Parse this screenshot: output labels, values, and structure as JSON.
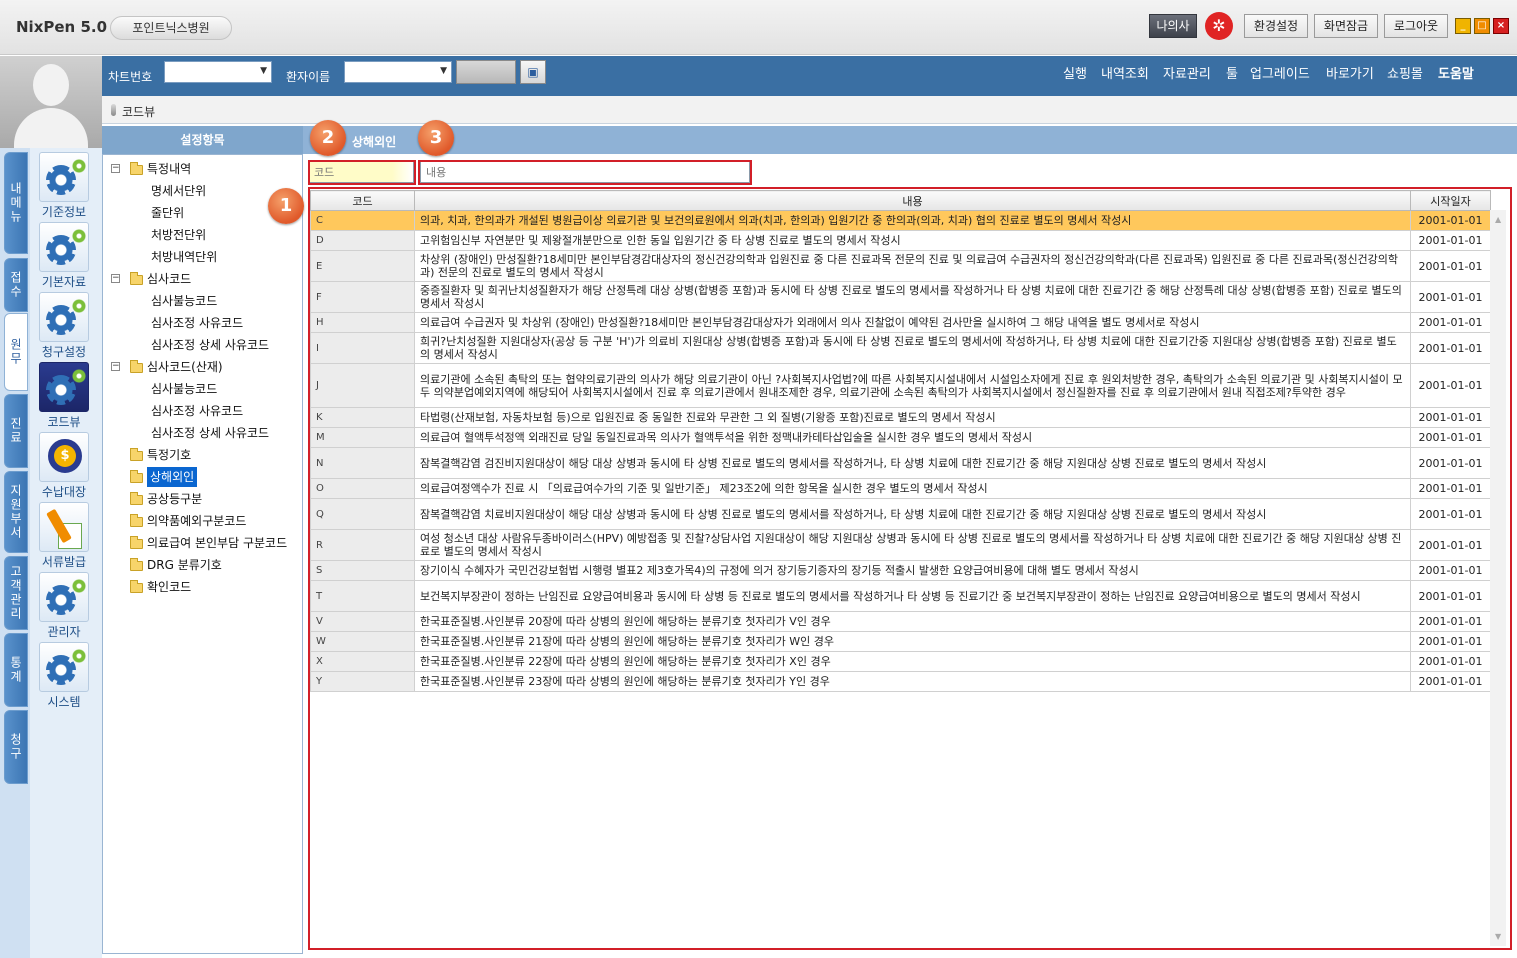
{
  "app": {
    "title": "NixPen 5.0",
    "hospital": "포인트닉스병원"
  },
  "header_buttons": {
    "my_doctor": "나의사",
    "settings": "환경설정",
    "screen_lock": "화면잠금",
    "logout": "로그아웃"
  },
  "window_controls": {
    "minimize": "_",
    "maximize": "□",
    "close": "×"
  },
  "toolbar": {
    "chart_no_label": "차트번호",
    "patient_name_label": "환자이름",
    "menu": [
      "실행",
      "내역조회",
      "자료관리",
      "툴",
      "업그레이드",
      "바로가기",
      "쇼핑몰",
      "도움말"
    ]
  },
  "breadcrumb": "코드뷰",
  "section": {
    "left_title": "설정항목",
    "right_title": "상해외인"
  },
  "vertical_tabs": [
    "내메뉴",
    "접수",
    "원무",
    "진료",
    "지원부서",
    "고객관리",
    "통계",
    "청구"
  ],
  "nav_icons": [
    {
      "label": "기준정보",
      "icon": "gear-icon"
    },
    {
      "label": "기본자료",
      "icon": "gear-icon"
    },
    {
      "label": "청구설정",
      "icon": "gear-icon"
    },
    {
      "label": "코드뷰",
      "icon": "gear-icon"
    },
    {
      "label": "수납대장",
      "icon": "coin-icon"
    },
    {
      "label": "서류발급",
      "icon": "document-pen-icon"
    },
    {
      "label": "관리자",
      "icon": "gear-icon"
    },
    {
      "label": "시스템",
      "icon": "gear-icon"
    }
  ],
  "tree": [
    {
      "label": "특정내역",
      "level": 0,
      "expandable": true
    },
    {
      "label": "명세서단위",
      "level": 1
    },
    {
      "label": "줄단위",
      "level": 1
    },
    {
      "label": "처방전단위",
      "level": 1
    },
    {
      "label": "처방내역단위",
      "level": 1
    },
    {
      "label": "심사코드",
      "level": 0,
      "expandable": true
    },
    {
      "label": "심사불능코드",
      "level": 1
    },
    {
      "label": "심사조정 사유코드",
      "level": 1
    },
    {
      "label": "심사조정 상세 사유코드",
      "level": 1
    },
    {
      "label": "심사코드(산재)",
      "level": 0,
      "expandable": true
    },
    {
      "label": "심사불능코드",
      "level": 1
    },
    {
      "label": "심사조정 사유코드",
      "level": 1
    },
    {
      "label": "심사조정 상세 사유코드",
      "level": 1
    },
    {
      "label": "특정기호",
      "level": 0
    },
    {
      "label": "상해외인",
      "level": 0,
      "selected": true
    },
    {
      "label": "공상등구분",
      "level": 0
    },
    {
      "label": "의약품예외구분코드",
      "level": 0
    },
    {
      "label": "의료급여 본인부담 구분코드",
      "level": 0
    },
    {
      "label": "DRG 분류기호",
      "level": 0
    },
    {
      "label": "확인코드",
      "level": 0
    }
  ],
  "search": {
    "code_placeholder": "코드",
    "content_placeholder": "내용"
  },
  "badges": [
    "1",
    "2",
    "3"
  ],
  "table": {
    "columns": [
      "코드",
      "내용",
      "시작일자"
    ],
    "rows": [
      {
        "code": "C",
        "desc": "의과, 치과, 한의과가 개설된 병원급이상 의료기관 및 보건의료원에서 의과(치과, 한의과) 입원기간 중 한의과(의과, 치과) 협의 진료로 별도의 명세서 작성시",
        "date": "2001-01-01",
        "lines": 1,
        "selected": true
      },
      {
        "code": "D",
        "desc": "고위험임신부 자연분만 및 제왕절개분만으로 인한 동일 입원기간 중 타 상병 진료로 별도의 명세서 작성시",
        "date": "2001-01-01",
        "lines": 1
      },
      {
        "code": "E",
        "desc": "차상위 (장애인) 만성질환?18세미만 본인부담경감대상자의 정신건강의학과 입원진료 중 다른 진료과목 전문의 진료 및 의료급여 수급권자의 정신건강의학과(다른 진료과목) 입원진료 중 다른 진료과목(정신건강의학과) 전문의 진료로 별도의 명세서 작성시",
        "date": "2001-01-01",
        "lines": 2
      },
      {
        "code": "F",
        "desc": "중증질환자 및 희귀난치성질환자가 해당 산정특례 대상 상병(합병증 포함)과 동시에 타 상병 진료로 별도의 명세서를 작성하거나 타 상병 치료에 대한 진료기간 중 해당 산정특례 대상 상병(합병증 포함) 진료로 별도의 명세서 작성시",
        "date": "2001-01-01",
        "lines": 2
      },
      {
        "code": "H",
        "desc": "의료급여 수급권자 및 차상위 (장애인) 만성질환?18세미만 본인부담경감대상자가 외래에서 의사 진찰없이 예약된 검사만을 실시하여 그 해당 내역을 별도 명세서로 작성시",
        "date": "2001-01-01",
        "lines": 1
      },
      {
        "code": "I",
        "desc": "희귀?난치성질환 지원대상자(공상 등 구분 'H')가 의료비 지원대상 상병(합병증 포함)과 동시에 타 상병 진료로 별도의 명세서에 작성하거나, 타 상병 치료에 대한 진료기간중 지원대상 상병(합병증 포함) 진료로 별도의 명세서 작성시",
        "date": "2001-01-01",
        "lines": 2
      },
      {
        "code": "J",
        "desc": "의료기관에 소속된 촉탁의 또는 협약의료기관의 의사가 해당 의료기관이 아닌 ?사회복지사업법?에 따른 사회복지시설내에서 시설입소자에게 진료 후 원외처방한 경우, 촉탁의가 소속된 의료기관 및 사회복지시설이 모두 의약분업예외지역에 해당되어 사회복지시설에서 진료 후 의료기관에서 원내조제한 경우, 의료기관에 소속된 촉탁의가 사회복지시설에서 정신질환자를 진료 후 의료기관에서 원내 직접조제?투약한 경우",
        "date": "2001-01-01",
        "lines": 3
      },
      {
        "code": "K",
        "desc": "타법령(산재보험, 자동차보험 등)으로 입원진료 중 동일한 진료와 무관한 그 외 질병(기왕증 포함)진료로 별도의 명세서 작성시",
        "date": "2001-01-01",
        "lines": 1
      },
      {
        "code": "M",
        "desc": "의료급여 혈액투석정액 외래진료 당일 동일진료과목 의사가 혈액투석을 위한 정맥내카테타삽입술을 실시한 경우 별도의 명세서 작성시",
        "date": "2001-01-01",
        "lines": 1
      },
      {
        "code": "N",
        "desc": "잠복결핵감염 검진비지원대상이 해당 대상 상병과 동시에 타 상병 진료로 별도의 명세서를 작성하거나, 타 상병 치료에 대한 진료기간 중 해당 지원대상 상병 진료로 별도의 명세서 작성시",
        "date": "2001-01-01",
        "lines": 2
      },
      {
        "code": "O",
        "desc": "의료급여정액수가 진료 시 「의료급여수가의 기준 및 일반기준」 제23조2에 의한 항목을 실시한 경우 별도의 명세서 작성시",
        "date": "2001-01-01",
        "lines": 1
      },
      {
        "code": "Q",
        "desc": "잠복결핵감염 치료비지원대상이 해당 대상 상병과 동시에 타 상병 진료로 별도의 명세서를 작성하거나, 타 상병 치료에 대한 진료기간 중 해당 지원대상 상병 진료로 별도의 명세서 작성시",
        "date": "2001-01-01",
        "lines": 2
      },
      {
        "code": "R",
        "desc": "여성 청소년 대상 사람유두종바이러스(HPV) 예방접종 및 진찰?상담사업 지원대상이 해당 지원대상 상병과 동시에 타 상병 진료로 별도의 명세서를 작성하거나 타 상병 치료에 대한 진료기간 중 해당 지원대상 상병 진료로 별도의 명세서 작성시",
        "date": "2001-01-01",
        "lines": 2
      },
      {
        "code": "S",
        "desc": "장기이식 수혜자가 국민건강보험법 시행령 별표2 제3호가목4)의 규정에 의거 장기등기증자의 장기등 적출시 발생한 요양급여비용에 대해 별도 명세서 작성시",
        "date": "2001-01-01",
        "lines": 1
      },
      {
        "code": "T",
        "desc": "보건복지부장관이 정하는 난임진료 요양급여비용과 동시에 타 상병 등 진료로 별도의 명세서를 작성하거나 타 상병 등 진료기간 중 보건복지부장관이 정하는 난임진료 요양급여비용으로 별도의 명세서 작성시",
        "date": "2001-01-01",
        "lines": 2
      },
      {
        "code": "V",
        "desc": "한국표준질병.사인분류 20장에 따라 상병의 원인에 해당하는 분류기호 첫자리가 V인 경우",
        "date": "2001-01-01",
        "lines": 1
      },
      {
        "code": "W",
        "desc": "한국표준질병.사인분류 21장에 따라 상병의 원인에 해당하는 분류기호 첫자리가 W인 경우",
        "date": "2001-01-01",
        "lines": 1
      },
      {
        "code": "X",
        "desc": "한국표준질병.사인분류 22장에 따라 상병의 원인에 해당하는 분류기호 첫자리가 X인 경우",
        "date": "2001-01-01",
        "lines": 1
      },
      {
        "code": "Y",
        "desc": "한국표준질병.사인분류 23장에 따라 상병의 원인에 해당하는 분류기호 첫자리가 Y인 경우",
        "date": "2001-01-01",
        "lines": 1
      }
    ]
  },
  "colors": {
    "toolbar_blue": "#3a6fa3",
    "section_blue": "#8fb2d6",
    "selected_row": "#ffc85c",
    "highlight_red": "#d21f28",
    "badge_orange": "#e0592a"
  }
}
